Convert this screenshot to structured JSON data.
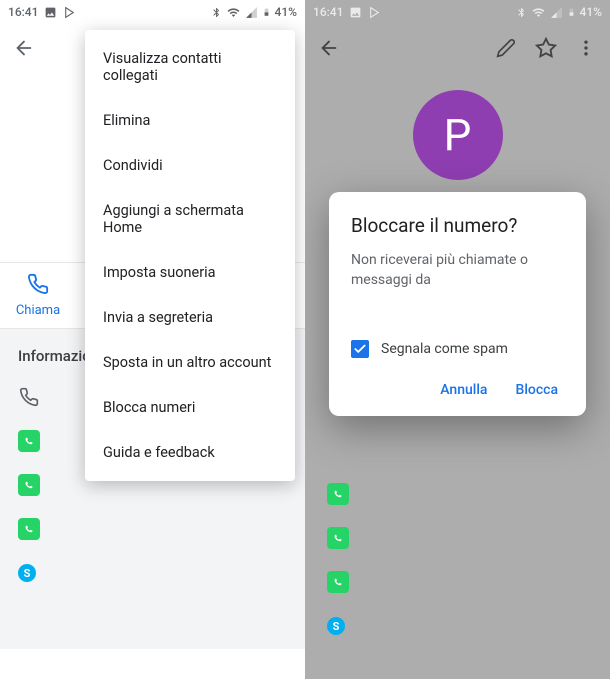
{
  "status": {
    "time": "16:41",
    "battery": "41%"
  },
  "left": {
    "action_call": "Chiama",
    "section_info": "Informazioni",
    "menu": {
      "items": [
        "Visualizza contatti collegati",
        "Elimina",
        "Condividi",
        "Aggiungi a schermata Home",
        "Imposta suoneria",
        "Invia a segreteria",
        "Sposta in un altro account",
        "Blocca numeri",
        "Guida e feedback"
      ]
    }
  },
  "right": {
    "avatar_initial": "P",
    "dialog": {
      "title": "Bloccare il numero?",
      "body": "Non riceverai più chiamate o messaggi da",
      "checkbox_label": "Segnala come spam",
      "cancel": "Annulla",
      "confirm": "Blocca"
    }
  }
}
